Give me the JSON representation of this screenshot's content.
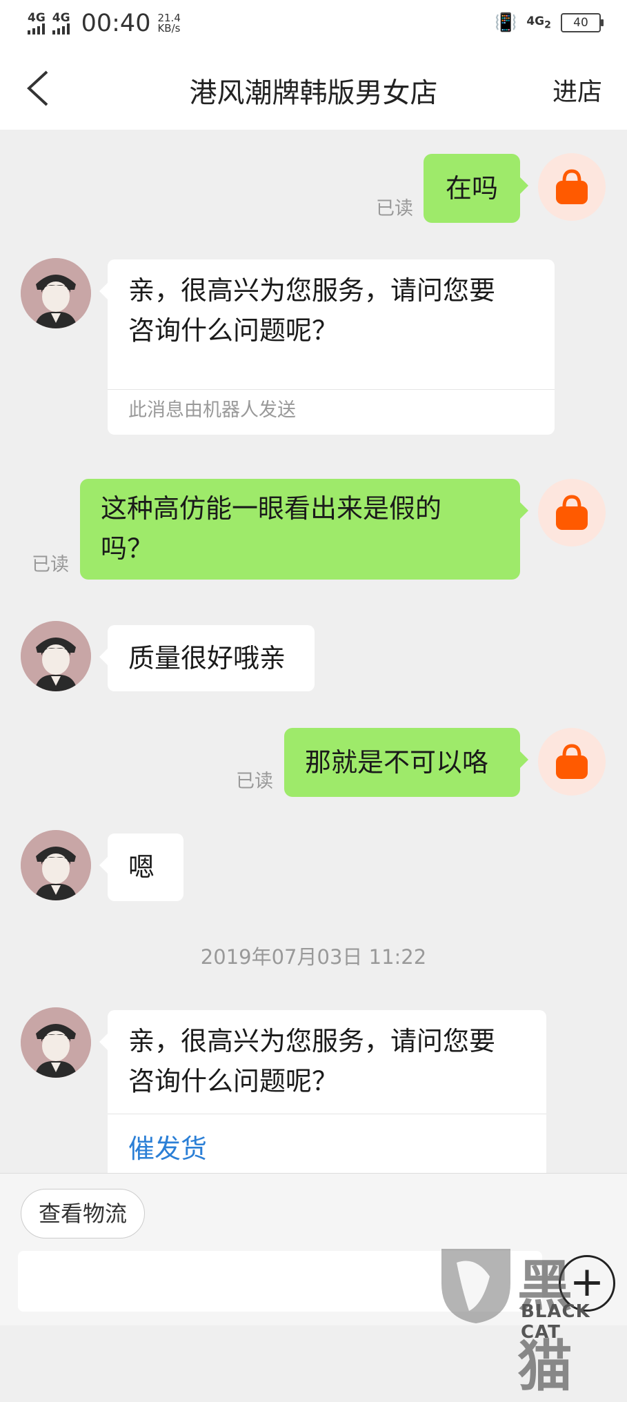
{
  "status_bar": {
    "network1": "4G",
    "network2": "4G",
    "time": "00:40",
    "speed_value": "21.4",
    "speed_unit": "KB/s",
    "network3": "4G",
    "network3_sub": "2",
    "battery": "40"
  },
  "header": {
    "title": "港风潮牌韩版男女店",
    "enter_label": "进店"
  },
  "messages": [
    {
      "sender": "me",
      "text": "在吗",
      "read": "已读"
    },
    {
      "sender": "agent",
      "text_line1": "亲，很高兴为您服务，请问您要",
      "text_line2": "咨询什么问题呢？",
      "note": "此消息由机器人发送"
    },
    {
      "sender": "me",
      "text_line1": "这种高仿能一眼看出来是假的",
      "text_line2": "吗？",
      "read": "已读"
    },
    {
      "sender": "agent",
      "text": "质量很好哦亲"
    },
    {
      "sender": "me",
      "text": "那就是不可以咯",
      "read": "已读"
    },
    {
      "sender": "agent",
      "text": "嗯"
    }
  ],
  "timestamp": "2019年07月03日 11:22",
  "last_agent_message": {
    "text_line1": "亲，很高兴为您服务，请问您要",
    "text_line2": "咨询什么问题呢？",
    "action": "催发货"
  },
  "bottom_bar": {
    "quick_action": "查看物流",
    "input_value": ""
  },
  "watermark": {
    "text": "BLACK CAT",
    "big_text": "黑猫"
  },
  "colors": {
    "my_bubble": "#9eea6a",
    "link": "#2b7fd6",
    "shop_avatar_bag": "#ff5a00"
  }
}
